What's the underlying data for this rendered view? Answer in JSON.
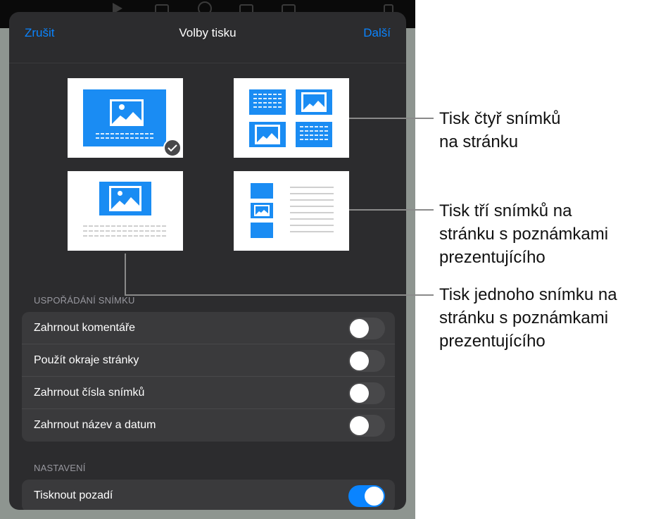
{
  "modal": {
    "cancel_label": "Zrušit",
    "title": "Volby tisku",
    "next_label": "Další"
  },
  "layouts": [
    {
      "id": "one-slide",
      "selected": true
    },
    {
      "id": "four-slides",
      "selected": false
    },
    {
      "id": "one-slide-notes",
      "selected": false
    },
    {
      "id": "three-slides-notes",
      "selected": false
    }
  ],
  "slide_layout_section": {
    "header": "USPOŘÁDÁNÍ SNÍMKU",
    "rows": [
      {
        "label": "Zahrnout komentáře",
        "on": false
      },
      {
        "label": "Použít okraje stránky",
        "on": false
      },
      {
        "label": "Zahrnout čísla snímků",
        "on": false
      },
      {
        "label": "Zahrnout název a datum",
        "on": false
      }
    ]
  },
  "settings_section": {
    "header": "NASTAVENÍ",
    "rows": [
      {
        "label": "Tisknout pozadí",
        "on": true
      }
    ]
  },
  "callouts": {
    "four_slides": "Tisk čtyř snímků\nna stránku",
    "three_slides_notes": "Tisk tří snímků na\nstránku s poznámkami\nprezentujícího",
    "one_slide_notes": "Tisk jednoho snímku na\nstránku s poznámkami\nprezentujícího"
  },
  "colors": {
    "accent": "#0a84ff",
    "thumbnail_blue": "#1a8cf3",
    "modal_bg": "#2c2c2e",
    "row_bg": "#3a3a3c"
  }
}
